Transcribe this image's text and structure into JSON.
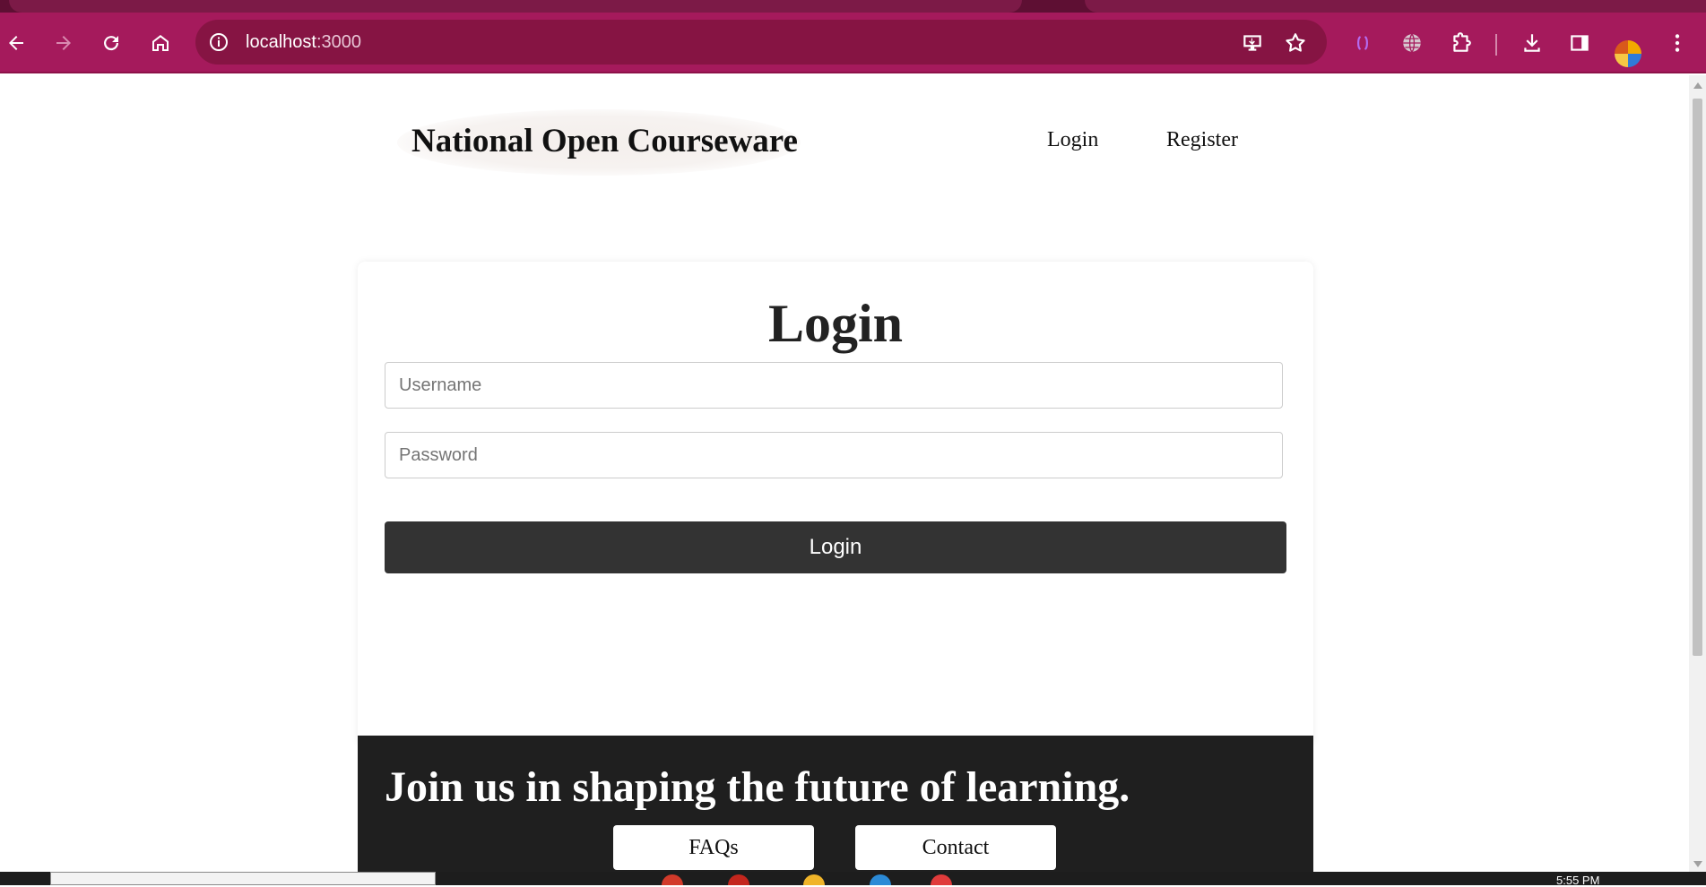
{
  "browser": {
    "url_host": "localhost",
    "url_port": ":3000",
    "icons": [
      "back-arrow-icon",
      "forward-arrow-icon",
      "reload-icon",
      "home-icon",
      "site-info-icon",
      "install-app-icon",
      "bookmark-star-icon",
      "extension-bracket-icon",
      "globe-icon",
      "extensions-puzzle-icon",
      "download-icon",
      "side-panel-icon",
      "profile-avatar",
      "menu-kebab-icon"
    ]
  },
  "header": {
    "brand": "National Open Courseware",
    "nav": [
      {
        "label": "Login"
      },
      {
        "label": "Register"
      }
    ]
  },
  "login_form": {
    "title": "Login",
    "username_placeholder": "Username",
    "password_placeholder": "Password",
    "submit_label": "Login"
  },
  "footer": {
    "tagline": "Join us in shaping the future of learning.",
    "buttons": [
      {
        "label": "FAQs"
      },
      {
        "label": "Contact"
      }
    ]
  },
  "taskbar": {
    "time": "5:55 PM"
  },
  "colors": {
    "browser_toolbar": "#a51a5c",
    "omnibox": "#861443",
    "login_button": "#333333",
    "footer_bg": "#1f1f1f"
  }
}
